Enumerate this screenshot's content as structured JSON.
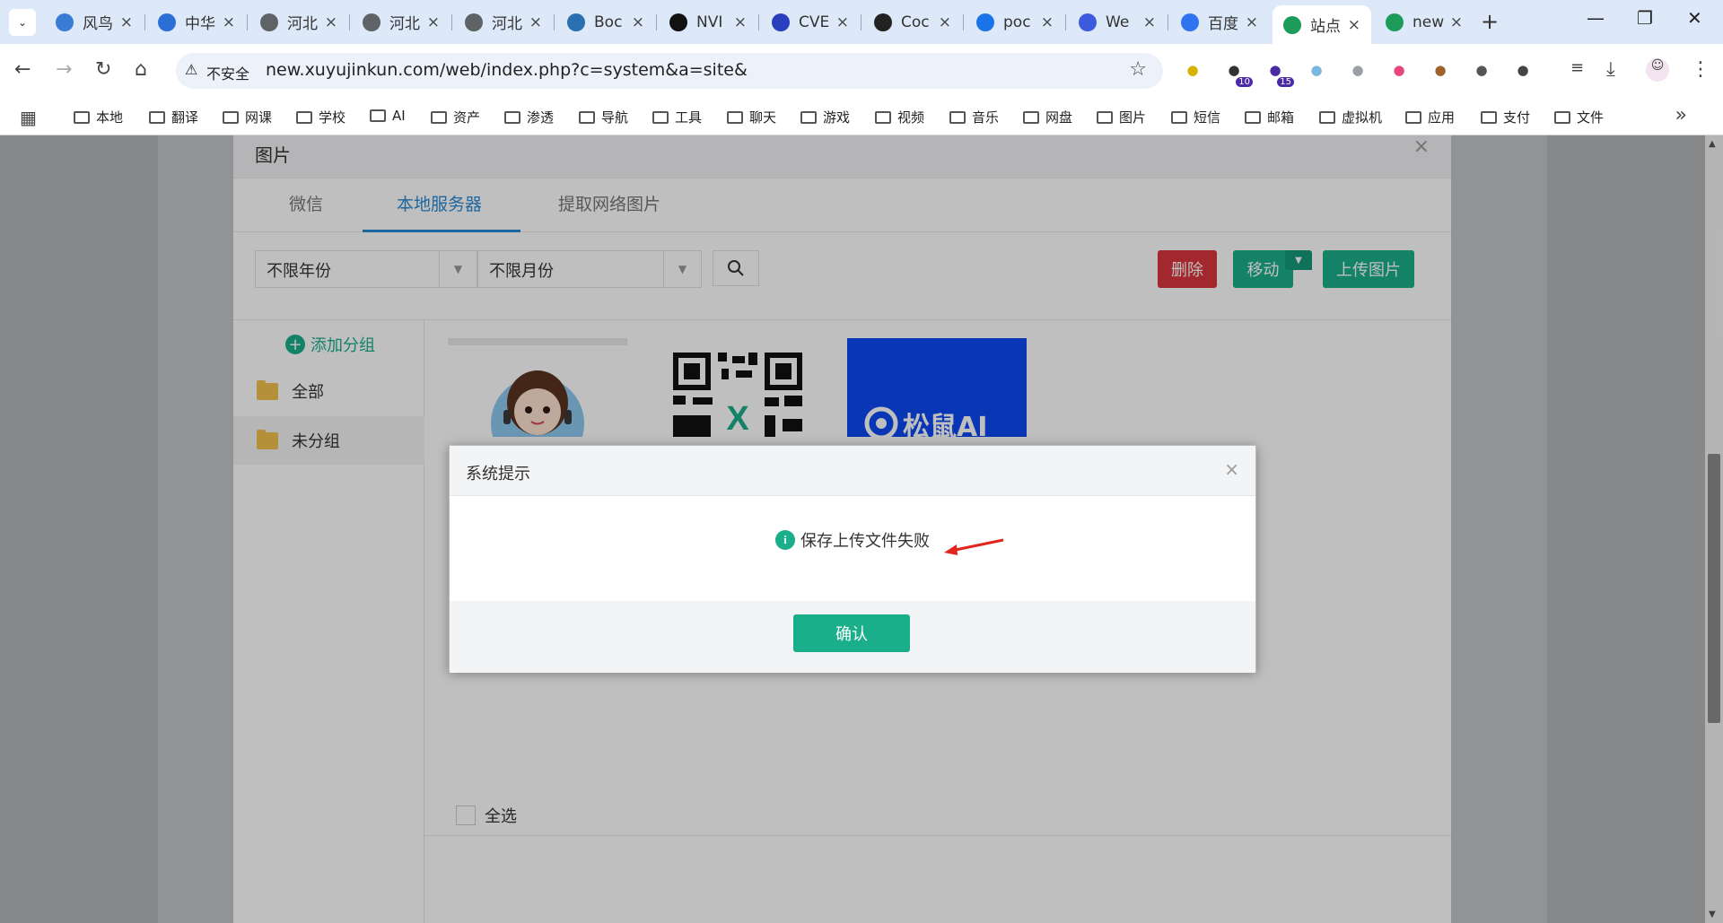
{
  "browser": {
    "tabs": [
      {
        "title": "风鸟",
        "icon": "shield-icon",
        "color": "#3a7bd5"
      },
      {
        "title": "中华",
        "icon": "shield-icon",
        "color": "#2b6fd6"
      },
      {
        "title": "河北",
        "icon": "globe-icon",
        "color": "#5f6368"
      },
      {
        "title": "河北",
        "icon": "globe-icon",
        "color": "#5f6368"
      },
      {
        "title": "河北",
        "icon": "globe-icon",
        "color": "#5f6368"
      },
      {
        "title": "Boc",
        "icon": "globe-icon",
        "color": "#2a6fb0"
      },
      {
        "title": "NVI",
        "icon": "nvidia-icon",
        "color": "#111111"
      },
      {
        "title": "CVE",
        "icon": "baidu-paw-icon",
        "color": "#2a3fbd"
      },
      {
        "title": "Coc",
        "icon": "github-icon",
        "color": "#222222"
      },
      {
        "title": "poc",
        "icon": "drive-icon",
        "color": "#1a73e8"
      },
      {
        "title": "We",
        "icon": "play-icon",
        "color": "#3b5bdb"
      },
      {
        "title": "百度",
        "icon": "translate-icon",
        "color": "#2f73f0"
      },
      {
        "title": "站点",
        "icon": "site-icon",
        "color": "#1c9b5a",
        "active": true
      },
      {
        "title": "new",
        "icon": "site-icon",
        "color": "#1c9b5a"
      }
    ],
    "insecure_label": "不安全",
    "url": "new.xuyujinkun.com/web/index.php?c=system&a=site&",
    "extensions": [
      {
        "icon": "circle-ext-icon",
        "color": "#d6b300"
      },
      {
        "icon": "timer-ext-icon",
        "color": "#333333",
        "badge": "10"
      },
      {
        "icon": "hat-ext-icon",
        "color": "#4a2aa5",
        "badge": "15"
      },
      {
        "icon": "figure-ext-icon",
        "color": "#7ab8e0"
      },
      {
        "icon": "bars-ext-icon",
        "color": "#9aa0a6"
      },
      {
        "icon": "translate-ext-icon",
        "color": "#e8457a"
      },
      {
        "icon": "cookie-ext-icon",
        "color": "#a0622d"
      },
      {
        "icon": "hat2-ext-icon",
        "color": "#555555"
      },
      {
        "icon": "puzzle-icon",
        "color": "#444444"
      }
    ],
    "bookmarks": [
      "本地",
      "翻译",
      "网课",
      "学校",
      "AI",
      "资产",
      "渗透",
      "导航",
      "工具",
      "聊天",
      "游戏",
      "视频",
      "音乐",
      "网盘",
      "图片",
      "短信",
      "邮箱",
      "虚拟机",
      "应用",
      "支付",
      "文件"
    ]
  },
  "image_modal": {
    "title": "图片",
    "tabs": [
      "微信",
      "本地服务器",
      "提取网络图片"
    ],
    "active_tab": "本地服务器",
    "year_select": "不限年份",
    "month_select": "不限月份",
    "delete_label": "删除",
    "move_label": "移动",
    "upload_label": "上传图片",
    "add_group_label": "添加分组",
    "groups": [
      "全部",
      "未分组"
    ],
    "select_all_label": "全选",
    "logo_text": "松鼠AI"
  },
  "dialog": {
    "title": "系统提示",
    "message": "保存上传文件失败",
    "confirm_label": "确认"
  },
  "colors": {
    "accent": "#1aae8a",
    "danger": "#d9363e",
    "tab_active": "#2a8ad4"
  }
}
